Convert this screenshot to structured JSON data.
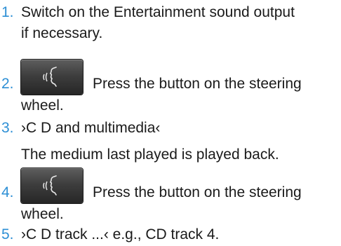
{
  "steps": [
    {
      "number": "1.",
      "line1": "Switch on the Entertainment sound output",
      "line2": "if necessary."
    },
    {
      "number": "2.",
      "icon": "voice-command-icon",
      "line1": "Press the button on the steering",
      "line2": "wheel."
    },
    {
      "number": "3.",
      "line1": "›C D and multimedia‹",
      "note": "The medium last played is played back."
    },
    {
      "number": "4.",
      "icon": "voice-command-icon",
      "line1": "Press the button on the steering",
      "line2": "wheel."
    },
    {
      "number": "5.",
      "line1": "›C D track ...‹ e.g., CD track 4."
    }
  ],
  "colors": {
    "step_number": "#2d8fd5",
    "text": "#1a1a1a",
    "button_background": "#3e3e3e",
    "icon": "#e6e6e6"
  }
}
